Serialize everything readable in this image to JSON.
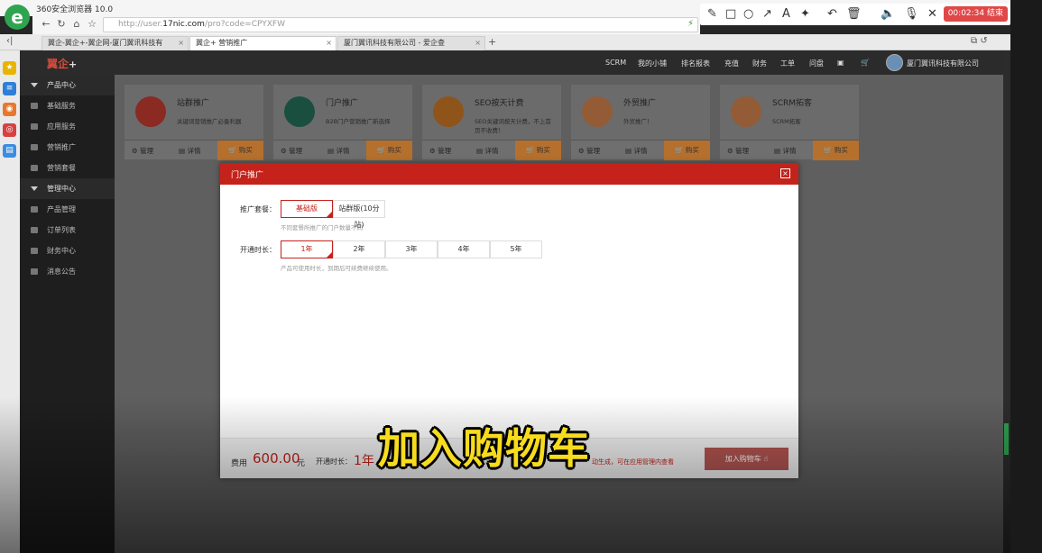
{
  "browser": {
    "title": "360安全浏览器 10.0",
    "url_prefix": "http://user.",
    "url_domain": "17nic.com",
    "url_path": "/pro?code=CPYXFW",
    "tabs": [
      {
        "label": "翼企-翼企+-翼企网-厦门翼讯科技有"
      },
      {
        "label": "翼企+ 营销推广"
      },
      {
        "label": "厦门翼讯科技有限公司 - 爱企查"
      }
    ],
    "recorder_time": "00:02:34 结束"
  },
  "site": {
    "logo": "翼企",
    "logo_plus": "+",
    "nav": [
      "SCRM",
      "我的小铺",
      "排名报表",
      "充值",
      "财务",
      "工单",
      "问盘"
    ],
    "company": "厦门翼讯科技有限公司",
    "sidebar": [
      {
        "label": "产品中心",
        "group": true
      },
      {
        "label": "基础服务"
      },
      {
        "label": "应用服务"
      },
      {
        "label": "营销推广"
      },
      {
        "label": "营销套餐"
      },
      {
        "label": "管理中心",
        "group": true
      },
      {
        "label": "产品管理"
      },
      {
        "label": "订单列表"
      },
      {
        "label": "财务中心"
      },
      {
        "label": "消息公告"
      }
    ],
    "cards": [
      {
        "title": "站群推广",
        "desc": "关键词营销推广必备利器",
        "color": "#b8372d"
      },
      {
        "title": "门户推广",
        "desc": "B2B门户营销推广新选择",
        "color": "#1f6b55"
      },
      {
        "title": "SEO按天计费",
        "desc": "SEO关键词按天计费，不上首页不收费！",
        "color": "#b0681f"
      },
      {
        "title": "外贸推广",
        "desc": "外贸推广！",
        "color": "#b36e3e"
      },
      {
        "title": "SCRM拓客",
        "desc": "SCRM拓客",
        "color": "#b36e3e"
      }
    ],
    "card_actions": {
      "manage": "管理",
      "detail": "详情",
      "buy": "购买"
    }
  },
  "modal": {
    "title": "门户推广",
    "package_label": "推广套餐：",
    "packages": [
      "基础版",
      "站群版(10分站)"
    ],
    "package_selected": 0,
    "package_hint": "不同套餐所推广的门户数量不同",
    "duration_label": "开通时长：",
    "durations": [
      "1年",
      "2年",
      "3年",
      "4年",
      "5年"
    ],
    "duration_selected": 0,
    "duration_hint": "产品可使用时长，到期后可续费继续使用。",
    "fee_label": "费用",
    "fee_amount": "600.00",
    "fee_unit": "元",
    "dur_summary_label": "开通时长：",
    "dur_summary_value": "1年",
    "foot_note": "动生成，可在应用管理内查看",
    "add_to_cart": "加入购物车"
  },
  "subtitle": "加入购物车"
}
